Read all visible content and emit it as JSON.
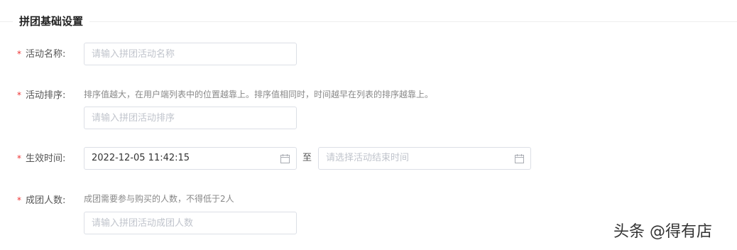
{
  "section": {
    "title": "拼团基础设置"
  },
  "fields": {
    "activity_name": {
      "required_mark": "*",
      "label": "活动名称:",
      "placeholder": "请输入拼团活动名称",
      "value": ""
    },
    "activity_sort": {
      "required_mark": "*",
      "label": "活动排序:",
      "hint": "排序值越大，在用户端列表中的位置越靠上。排序值相同时，时间越早在列表的排序越靠上。",
      "placeholder": "请输入拼团活动排序",
      "value": ""
    },
    "effective_time": {
      "required_mark": "*",
      "label": "生效时间:",
      "start_value": "2022-12-05 11:42:15",
      "separator": "至",
      "end_placeholder": "请选择活动结束时间",
      "icon": "calendar-icon"
    },
    "group_size": {
      "required_mark": "*",
      "label": "成团人数:",
      "hint": "成团需要参与购买的人数，不得低于2人",
      "placeholder": "请输入拼团活动成团人数",
      "value": ""
    }
  },
  "watermark": {
    "text": "头条 @得有店"
  },
  "colors": {
    "required": "#ee3333",
    "border": "#dcdfe6",
    "placeholder": "#c0c4cc",
    "hint": "#888888"
  }
}
